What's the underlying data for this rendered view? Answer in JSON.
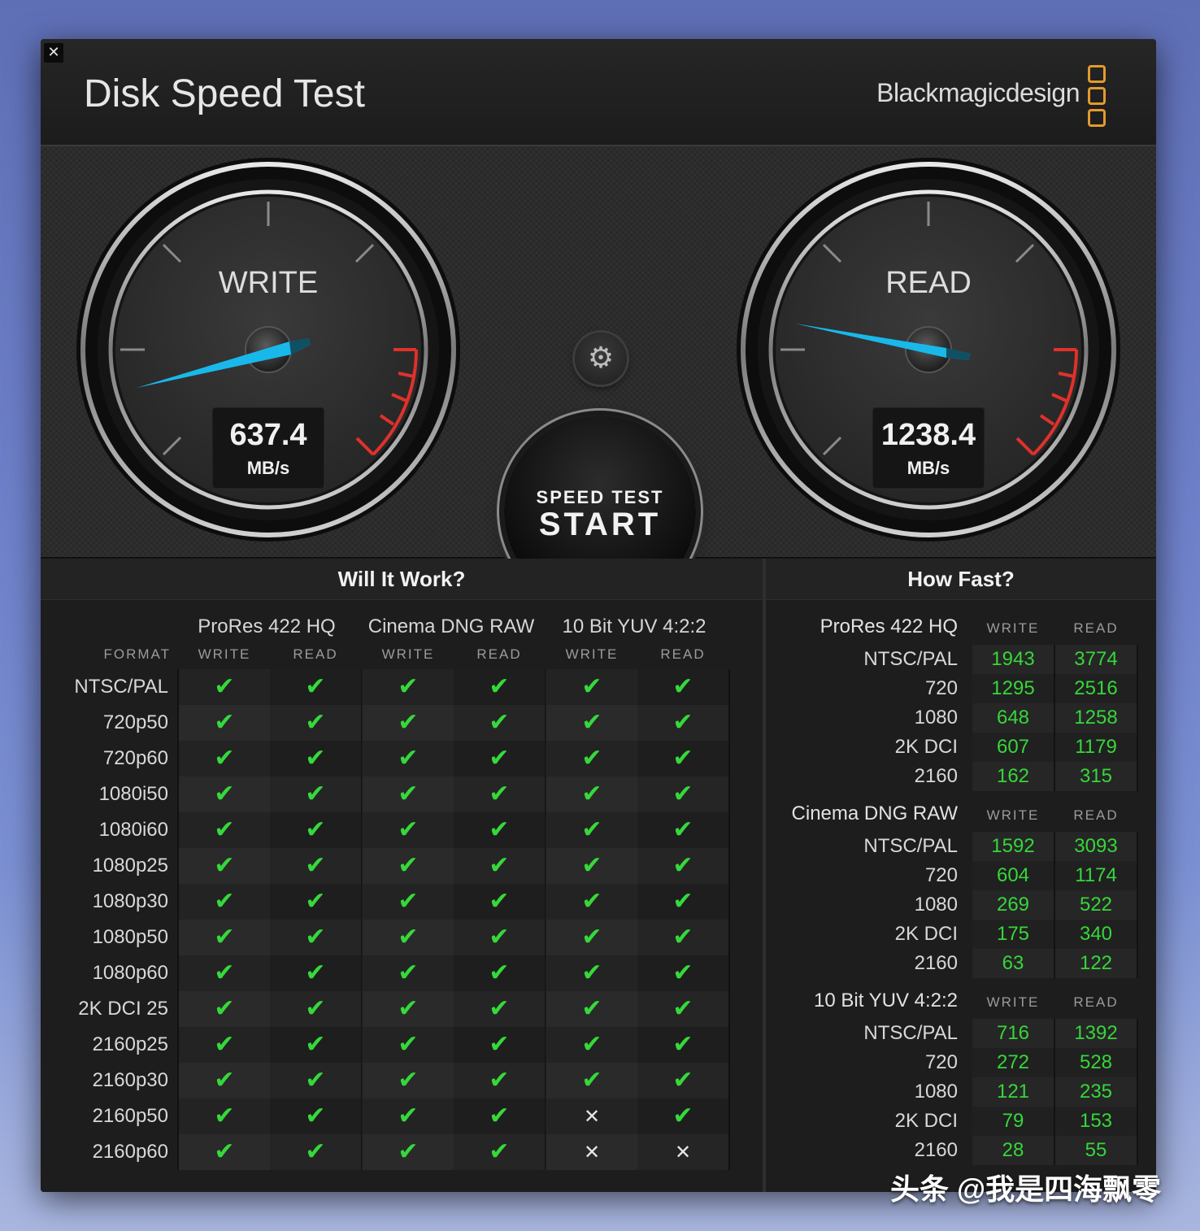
{
  "window": {
    "close_icon": "✕",
    "title": "Disk Speed Test",
    "brand": "Blackmagicdesign"
  },
  "gauges": {
    "write": {
      "title": "WRITE",
      "value": "637.4",
      "unit": "MB/s"
    },
    "read": {
      "title": "READ",
      "value": "1238.4",
      "unit": "MB/s"
    }
  },
  "start_button": {
    "sub": "SPEED TEST",
    "main": "START"
  },
  "settings_icon": "gear-icon",
  "will_it_work": {
    "header": "Will It Work?",
    "format_label": "FORMAT",
    "groups": [
      "ProRes 422 HQ",
      "Cinema DNG RAW",
      "10 Bit YUV 4:2:2"
    ],
    "columns": [
      "WRITE",
      "READ",
      "WRITE",
      "READ",
      "WRITE",
      "READ"
    ],
    "rows": [
      {
        "label": "NTSC/PAL",
        "cells": [
          1,
          1,
          1,
          1,
          1,
          1
        ]
      },
      {
        "label": "720p50",
        "cells": [
          1,
          1,
          1,
          1,
          1,
          1
        ]
      },
      {
        "label": "720p60",
        "cells": [
          1,
          1,
          1,
          1,
          1,
          1
        ]
      },
      {
        "label": "1080i50",
        "cells": [
          1,
          1,
          1,
          1,
          1,
          1
        ]
      },
      {
        "label": "1080i60",
        "cells": [
          1,
          1,
          1,
          1,
          1,
          1
        ]
      },
      {
        "label": "1080p25",
        "cells": [
          1,
          1,
          1,
          1,
          1,
          1
        ]
      },
      {
        "label": "1080p30",
        "cells": [
          1,
          1,
          1,
          1,
          1,
          1
        ]
      },
      {
        "label": "1080p50",
        "cells": [
          1,
          1,
          1,
          1,
          1,
          1
        ]
      },
      {
        "label": "1080p60",
        "cells": [
          1,
          1,
          1,
          1,
          1,
          1
        ]
      },
      {
        "label": "2K DCI 25",
        "cells": [
          1,
          1,
          1,
          1,
          1,
          1
        ]
      },
      {
        "label": "2160p25",
        "cells": [
          1,
          1,
          1,
          1,
          1,
          1
        ]
      },
      {
        "label": "2160p30",
        "cells": [
          1,
          1,
          1,
          1,
          1,
          1
        ]
      },
      {
        "label": "2160p50",
        "cells": [
          1,
          1,
          1,
          1,
          0,
          1
        ]
      },
      {
        "label": "2160p60",
        "cells": [
          1,
          1,
          1,
          1,
          0,
          0
        ]
      }
    ],
    "check_glyph": "✔",
    "cross_glyph": "✕"
  },
  "how_fast": {
    "header": "How Fast?",
    "write_label": "WRITE",
    "read_label": "READ",
    "sections": [
      {
        "title": "ProRes 422 HQ",
        "rows": [
          {
            "label": "NTSC/PAL",
            "write": "1943",
            "read": "3774"
          },
          {
            "label": "720",
            "write": "1295",
            "read": "2516"
          },
          {
            "label": "1080",
            "write": "648",
            "read": "1258"
          },
          {
            "label": "2K DCI",
            "write": "607",
            "read": "1179"
          },
          {
            "label": "2160",
            "write": "162",
            "read": "315"
          }
        ]
      },
      {
        "title": "Cinema DNG RAW",
        "rows": [
          {
            "label": "NTSC/PAL",
            "write": "1592",
            "read": "3093"
          },
          {
            "label": "720",
            "write": "604",
            "read": "1174"
          },
          {
            "label": "1080",
            "write": "269",
            "read": "522"
          },
          {
            "label": "2K DCI",
            "write": "175",
            "read": "340"
          },
          {
            "label": "2160",
            "write": "63",
            "read": "122"
          }
        ]
      },
      {
        "title": "10 Bit YUV 4:2:2",
        "rows": [
          {
            "label": "NTSC/PAL",
            "write": "716",
            "read": "1392"
          },
          {
            "label": "720",
            "write": "272",
            "read": "528"
          },
          {
            "label": "1080",
            "write": "121",
            "read": "235"
          },
          {
            "label": "2K DCI",
            "write": "79",
            "read": "153"
          },
          {
            "label": "2160",
            "write": "28",
            "read": "55"
          }
        ]
      }
    ]
  },
  "watermark": "头条 @我是四海飘零",
  "colors": {
    "check": "#35d93a",
    "value_green": "#36d63a",
    "needle": "#19b8ea",
    "redline": "#e0312b",
    "brand_logo": "#e39a2d"
  }
}
